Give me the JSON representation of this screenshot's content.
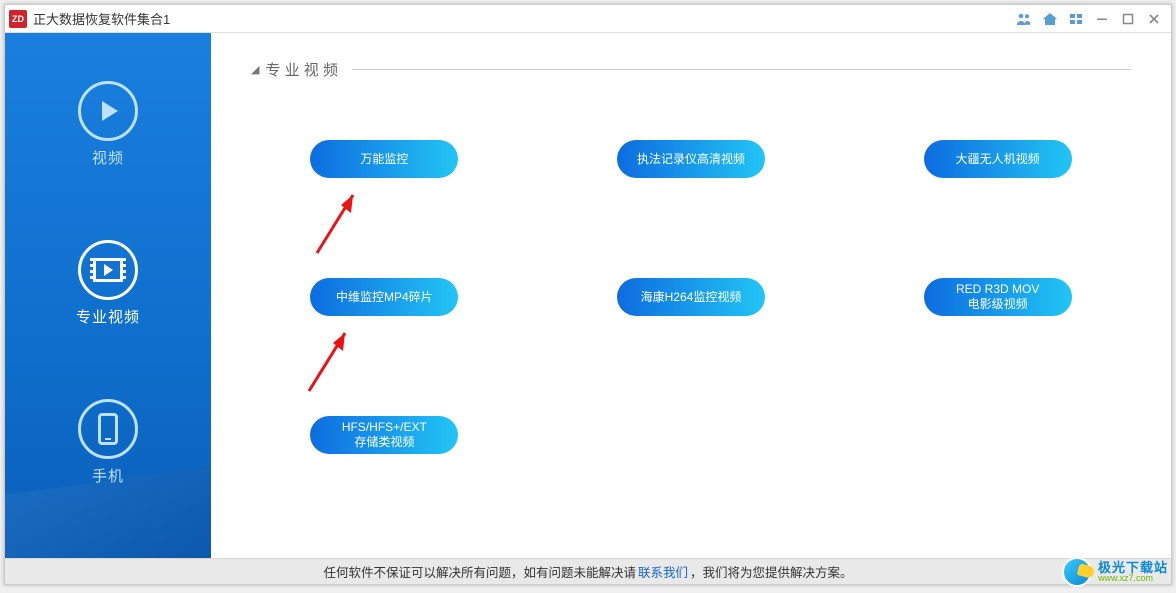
{
  "title": "正大数据恢复软件集合1",
  "logo_text": "ZD",
  "section_title": "专 业 视 频",
  "sidebar": [
    {
      "label": "视频",
      "icon": "play"
    },
    {
      "label": "专业视频",
      "icon": "film"
    },
    {
      "label": "手机",
      "icon": "phone"
    }
  ],
  "tools": [
    {
      "label": "万能监控"
    },
    {
      "label": "执法记录仪高清视频"
    },
    {
      "label": "大疆无人机视频"
    },
    {
      "label": "中维监控MP4碎片"
    },
    {
      "label": "海康H264监控视频"
    },
    {
      "label": "RED R3D MOV\n电影级视频"
    },
    {
      "label": "HFS/HFS+/EXT\n存储类视频"
    }
  ],
  "footer": {
    "t1": "任何软件不保证可以解决所有问题，如有问题未能解决请 ",
    "link": "联系我们",
    "t2": "，我们将为您提供解决方案。"
  },
  "watermark": {
    "cn": "极光下载站",
    "en": "www.xz7.com"
  }
}
